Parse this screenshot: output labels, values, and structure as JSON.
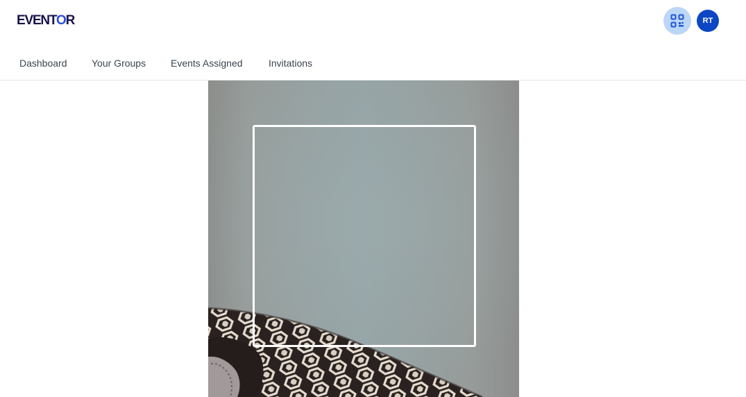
{
  "header": {
    "logo_text": "EVENTOR",
    "qr_icon": "qr-code-icon",
    "avatar_initials": "RT",
    "colors": {
      "logo": "#17124a",
      "logo_accent": "#2b4de0",
      "qr_button_bg": "#bcd6f7",
      "qr_icon": "#1e56d6",
      "avatar_bg": "#0b47c4"
    }
  },
  "nav": {
    "items": [
      {
        "label": "Dashboard"
      },
      {
        "label": "Your Groups"
      },
      {
        "label": "Events Assigned"
      },
      {
        "label": "Invitations"
      }
    ]
  },
  "scanner": {
    "frame_color": "#ffffff",
    "camera_feed": "camera-preview"
  }
}
